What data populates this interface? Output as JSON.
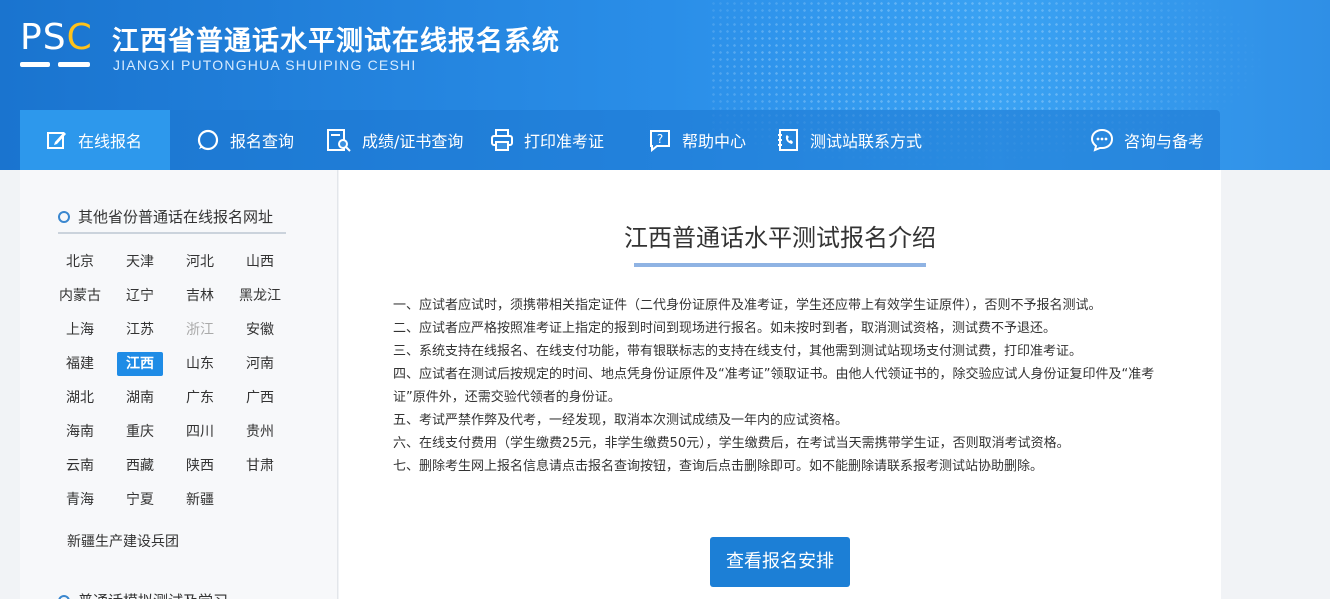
{
  "header": {
    "logo_text": "PSC",
    "title_cn": "江西省普通话水平测试在线报名系统",
    "title_en": "JIANGXI PUTONGHUA SHUIPING CESHI"
  },
  "nav": {
    "items": [
      {
        "label": "在线报名",
        "icon": "edit-icon"
      },
      {
        "label": "报名查询",
        "icon": "search-circle-icon"
      },
      {
        "label": "成绩/证书查询",
        "icon": "doc-search-icon"
      },
      {
        "label": "打印准考证",
        "icon": "printer-icon"
      },
      {
        "label": "帮助中心",
        "icon": "help-icon"
      },
      {
        "label": "测试站联系方式",
        "icon": "phone-book-icon"
      },
      {
        "label": "咨询与备考",
        "icon": "chat-icon"
      }
    ]
  },
  "sidebar": {
    "title": "其他省份普通话在线报名网址",
    "provinces": [
      "北京",
      "天津",
      "河北",
      "山西",
      "内蒙古",
      "辽宁",
      "吉林",
      "黑龙江",
      "上海",
      "江苏",
      "浙江",
      "安徽",
      "福建",
      "江西",
      "山东",
      "河南",
      "湖北",
      "湖南",
      "广东",
      "广西",
      "海南",
      "重庆",
      "四川",
      "贵州",
      "云南",
      "西藏",
      "陕西",
      "甘肃",
      "青海",
      "宁夏",
      "新疆"
    ],
    "active_province": "江西",
    "disabled_province": "浙江",
    "extra": "新疆生产建设兵团",
    "title2": "普通话模拟测试及学习"
  },
  "main": {
    "title": "江西普通话水平测试报名介绍",
    "rules": [
      "一、应试者应试时，须携带相关指定证件（二代身份证原件及准考证，学生还应带上有效学生证原件），否则不予报名测试。",
      "二、应试者应严格按照准考证上指定的报到时间到现场进行报名。如未按时到者，取消测试资格，测试费不予退还。",
      "三、系统支持在线报名、在线支付功能，带有银联标志的支持在线支付，其他需到测试站现场支付测试费，打印准考证。",
      "四、应试者在测试后按规定的时间、地点凭身份证原件及“准考证”领取证书。由他人代领证书的，除交验应试人身份证复印件及“准考证”原件外，还需交验代领者的身份证。",
      "五、考试严禁作弊及代考，一经发现，取消本次测试成绩及一年内的应试资格。",
      "六、在线支付费用（学生缴费25元，非学生缴费50元），学生缴费后，在考试当天需携带学生证，否则取消考试资格。",
      "七、删除考生网上报名信息请点击报名查询按钮，查询后点击删除即可。如不能删除请联系报考测试站协助删除。"
    ],
    "button_label": "查看报名安排"
  }
}
